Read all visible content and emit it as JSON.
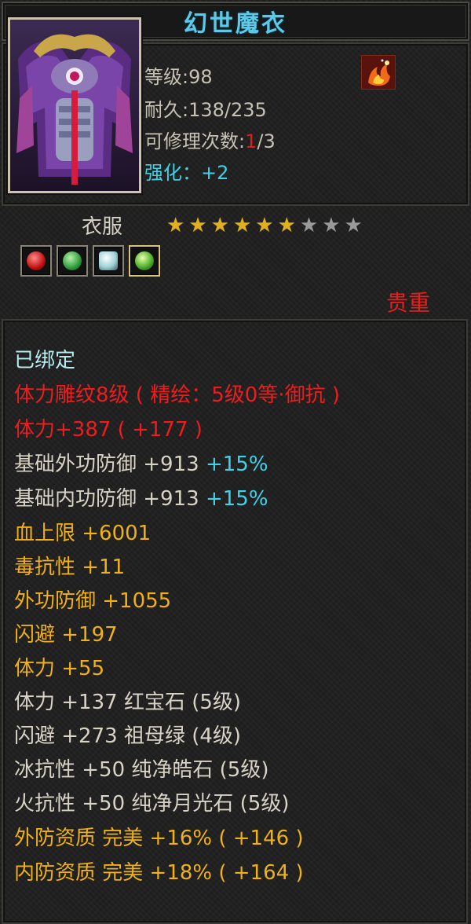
{
  "item": {
    "name": "幻世魔衣",
    "level_label": "等级",
    "level": "98",
    "durability_label": "耐久",
    "durability": "138/235",
    "repair_label": "可修理次数",
    "repair_used": "1",
    "repair_total": "/3",
    "strength_label": "强化",
    "strength_value": "+2",
    "type": "衣服",
    "stars": {
      "filled": 6,
      "total": 9
    },
    "quality": "贵重",
    "gems": [
      "red-gem-icon",
      "green-gem-icon",
      "white-gem-icon",
      "green-gem-icon"
    ]
  },
  "properties": [
    {
      "text": "已绑定",
      "color": "bound"
    },
    {
      "text": "体力雕纹8级 ( 精绘：5级0等·御抗 )",
      "color": "red"
    },
    {
      "text": "体力+387 ( +177 )",
      "color": "red"
    },
    {
      "text": "基础外功防御  +913",
      "extra": "+15%",
      "color": "white"
    },
    {
      "text": "基础内功防御  +913",
      "extra": "+15%",
      "color": "white"
    },
    {
      "text": "血上限  +6001",
      "color": "gold"
    },
    {
      "text": "毒抗性  +11",
      "color": "gold"
    },
    {
      "text": "外功防御  +1055",
      "color": "gold"
    },
    {
      "text": "闪避  +197",
      "color": "gold"
    },
    {
      "text": "体力  +55",
      "color": "gold"
    },
    {
      "text": "体力  +137  红宝石 (5级)",
      "color": "white"
    },
    {
      "text": "闪避  +273  祖母绿 (4级)",
      "color": "white"
    },
    {
      "text": "冰抗性  +50  纯净皓石 (5级)",
      "color": "white"
    },
    {
      "text": "火抗性  +50  纯净月光石 (5级)",
      "color": "white"
    },
    {
      "text": "外防资质   完美  +16% ( +146 )",
      "color": "gold"
    },
    {
      "text": "内防资质   完美  +18% ( +164 )",
      "color": "gold"
    }
  ]
}
